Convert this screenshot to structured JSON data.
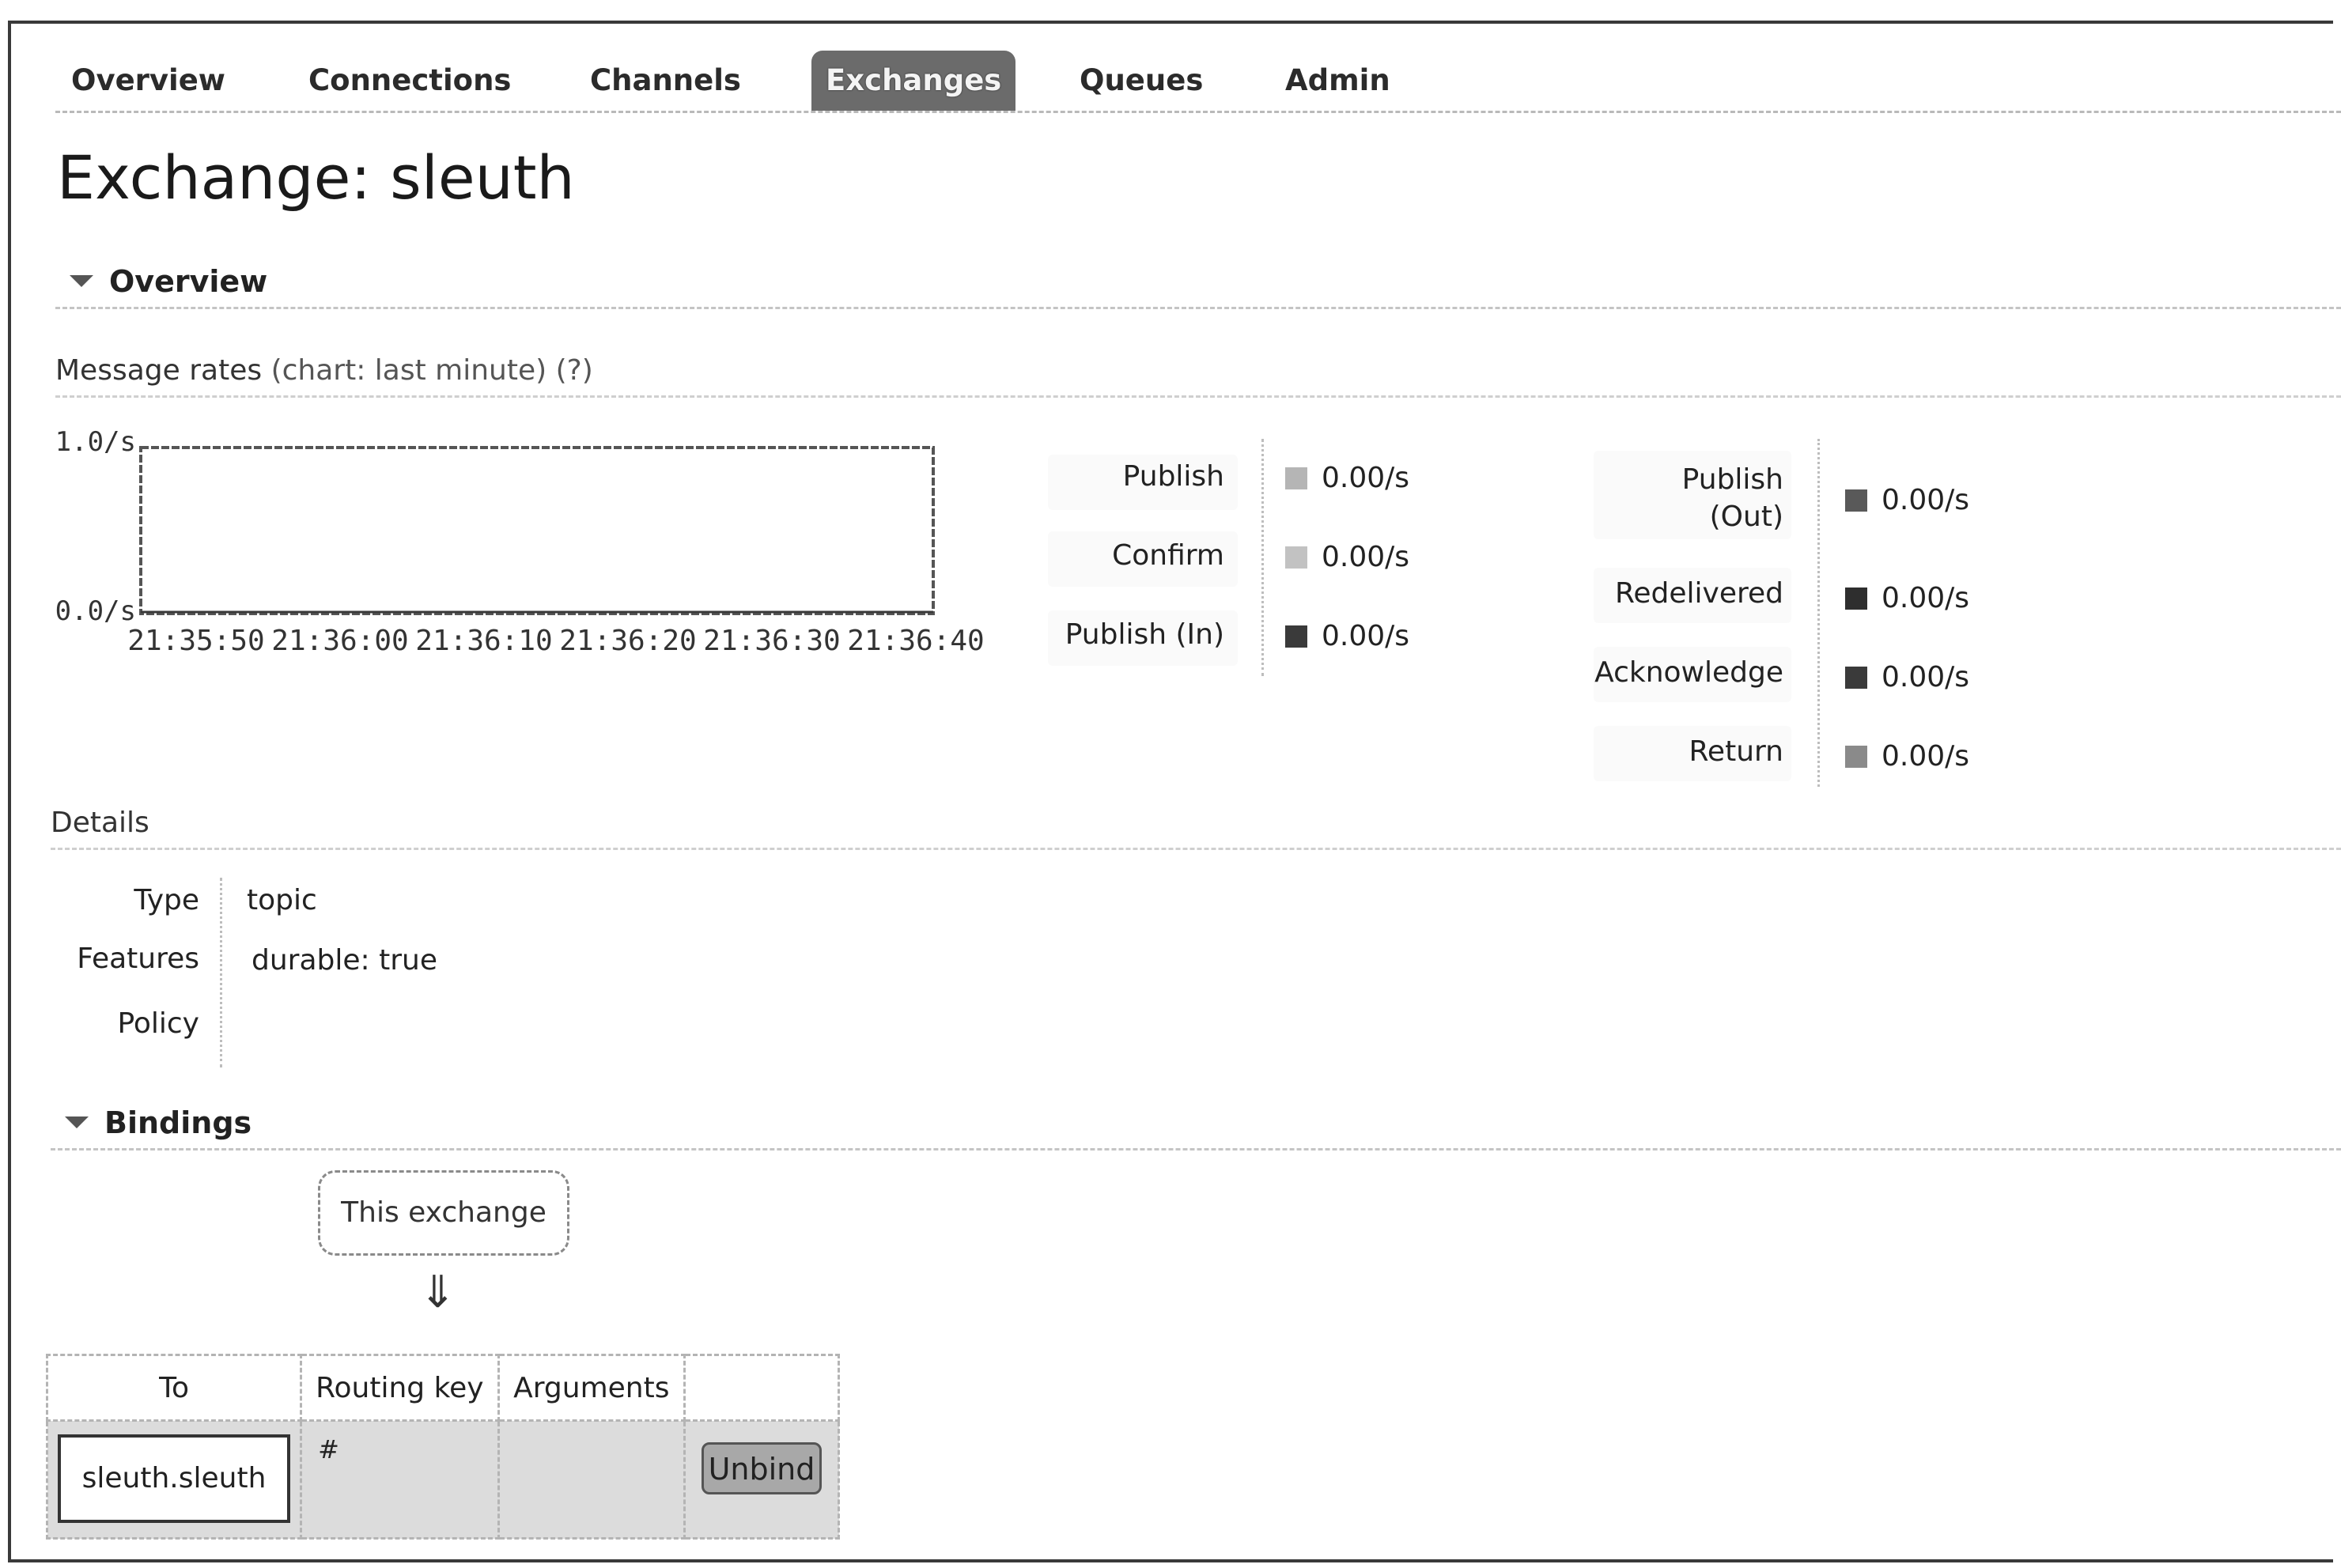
{
  "nav": {
    "tabs": [
      {
        "label": "Overview"
      },
      {
        "label": "Connections"
      },
      {
        "label": "Channels"
      },
      {
        "label": "Exchanges",
        "active": true
      },
      {
        "label": "Queues"
      },
      {
        "label": "Admin"
      }
    ]
  },
  "page": {
    "title": "Exchange: sleuth"
  },
  "overview": {
    "heading": "Overview",
    "message_rates": {
      "label": "Message rates",
      "hint": "(chart: last minute) (?)"
    }
  },
  "chart_data": {
    "type": "line",
    "title": "",
    "ylim": [
      0.0,
      1.0
    ],
    "y_tick_labels": [
      "1.0/s",
      "0.0/s"
    ],
    "x_tick_labels": [
      "21:35:50",
      "21:36:00",
      "21:36:10",
      "21:36:20",
      "21:36:30",
      "21:36:40"
    ],
    "series": [
      {
        "x": [
          "21:35:50",
          "21:36:00",
          "21:36:10",
          "21:36:20",
          "21:36:30",
          "21:36:40"
        ],
        "values": [
          0,
          0,
          0,
          0,
          0,
          0
        ]
      }
    ]
  },
  "rates_left": [
    {
      "label": "Publish",
      "value": "0.00/s",
      "color": "#b5b5b5"
    },
    {
      "label": "Confirm",
      "value": "0.00/s",
      "color": "#c2c2c2"
    },
    {
      "label": "Publish (In)",
      "value": "0.00/s",
      "color": "#3a3a3a"
    }
  ],
  "rates_right": [
    {
      "label_line1": "Publish",
      "label_line2": "(Out)",
      "value": "0.00/s",
      "color": "#595959"
    },
    {
      "label": "Redelivered",
      "value": "0.00/s",
      "color": "#2e2e2e"
    },
    {
      "label": "Acknowledge",
      "value": "0.00/s",
      "color": "#3a3a3a"
    },
    {
      "label": "Return",
      "value": "0.00/s",
      "color": "#8a8a8a"
    }
  ],
  "details": {
    "heading": "Details",
    "rows": [
      {
        "key": "Type",
        "value": "topic"
      },
      {
        "key": "Features",
        "value": "durable: true"
      },
      {
        "key": "Policy",
        "value": ""
      }
    ]
  },
  "bindings": {
    "heading": "Bindings",
    "this_exchange": "This exchange",
    "arrow": "⇓",
    "columns": [
      "To",
      "Routing key",
      "Arguments",
      ""
    ],
    "rows": [
      {
        "to": "sleuth.sleuth",
        "routing_key": "#",
        "arguments": "",
        "action": "Unbind"
      }
    ]
  }
}
